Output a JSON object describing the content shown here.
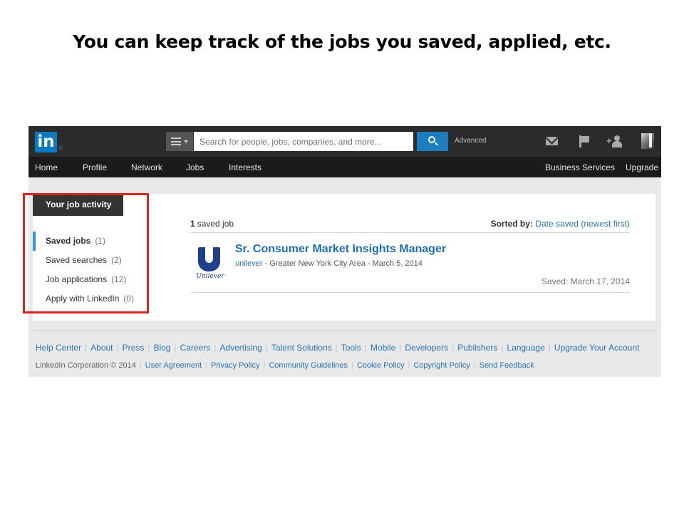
{
  "slide": {
    "title": "You can keep track of the jobs you saved, applied, etc."
  },
  "topbar": {
    "logo_text": "in",
    "logo_reg": "®",
    "search_placeholder": "Search for people, jobs, companies, and more...",
    "advanced_label": "Advanced",
    "icons": [
      "list-menu-icon",
      "search-icon",
      "mail-icon",
      "flag-icon",
      "add-connection-icon",
      "avatar"
    ]
  },
  "nav": {
    "items": [
      "Home",
      "Profile",
      "Network",
      "Jobs",
      "Interests"
    ],
    "right_items": [
      "Business Services",
      "Upgrade"
    ]
  },
  "activity": {
    "heading": "Your job activity",
    "items": [
      {
        "label": "Saved jobs",
        "count": "(1)"
      },
      {
        "label": "Saved searches",
        "count": "(2)"
      },
      {
        "label": "Job applications",
        "count": "(12)"
      },
      {
        "label": "Apply with LinkedIn",
        "count": "(0)"
      }
    ]
  },
  "results": {
    "count_number": "1",
    "count_label": "saved job",
    "sorted_label": "Sorted by:",
    "sorted_value": "Date saved (newest first)"
  },
  "job": {
    "title": "Sr. Consumer Market Insights Manager",
    "company": "unilever",
    "meta": " - Greater New York City Area - March 5, 2014",
    "logo_text": "Unilever",
    "saved_date": "Saved: March 17, 2014"
  },
  "footer": {
    "links": [
      "Help Center",
      "About",
      "Press",
      "Blog",
      "Careers",
      "Advertising",
      "Talent Solutions",
      "Tools",
      "Mobile",
      "Developers",
      "Publishers",
      "Language",
      "Upgrade Your Account"
    ],
    "copyright": "LinkedIn Corporation © 2014",
    "legal_links": [
      "User Agreement",
      "Privacy Policy",
      "Community Guidelines",
      "Cookie Policy",
      "Copyright Policy",
      "Send Feedback"
    ]
  },
  "colors": {
    "brand": "#0a7bc1",
    "link": "#2a73b5",
    "highlight_box": "#e0201b",
    "active_indicator": "#3d94d6"
  }
}
